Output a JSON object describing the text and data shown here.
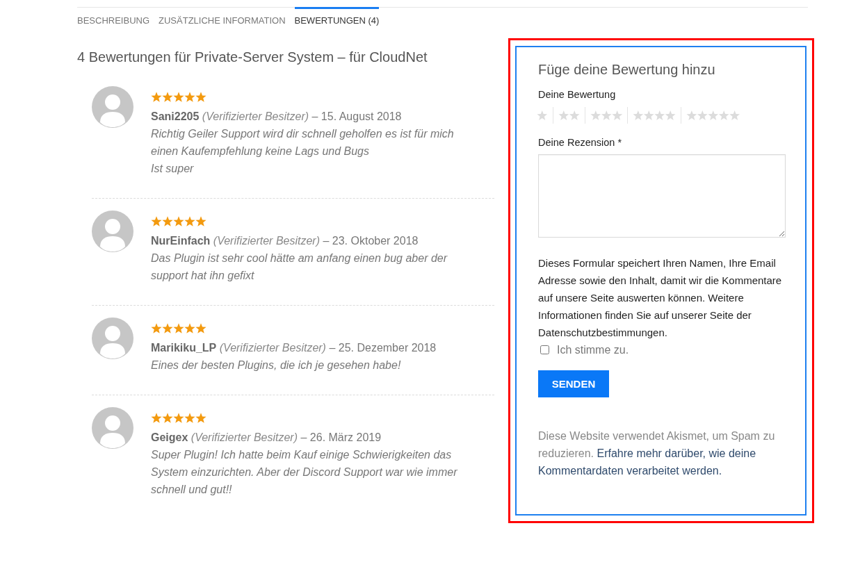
{
  "tabs": [
    {
      "label": "BESCHREIBUNG",
      "selected": false
    },
    {
      "label": "ZUSÄTZLICHE INFORMATION",
      "selected": false
    },
    {
      "label": "BEWERTUNGEN (4)",
      "selected": true
    }
  ],
  "reviews_title": "4 Bewertungen für Private-Server System – für CloudNet",
  "reviews": [
    {
      "stars": 5,
      "author": "Sani2205",
      "badge": "(Verifizierter Besitzer)",
      "date": "– 15. August 2018",
      "text": [
        "Richtig Geiler Support wird dir schnell geholfen es ist für mich einen Kaufempfehlung keine Lags und Bugs",
        "Ist super"
      ]
    },
    {
      "stars": 5,
      "author": "NurEinfach",
      "badge": "(Verifizierter Besitzer)",
      "date": "– 23. Oktober 2018",
      "text": [
        "Das Plugin ist sehr cool hätte am anfang einen bug aber der support hat ihn gefixt"
      ]
    },
    {
      "stars": 5,
      "author": "Marikiku_LP",
      "badge": "(Verifizierter Besitzer)",
      "date": "– 25. Dezember 2018",
      "text": [
        "Eines der besten Plugins, die ich je gesehen habe!"
      ]
    },
    {
      "stars": 5,
      "author": "Geigex",
      "badge": "(Verifizierter Besitzer)",
      "date": "– 26. März 2019",
      "text": [
        "Super Plugin! Ich hatte beim Kauf einige Schwierigkeiten das System einzurichten. Aber der Discord Support war wie immer schnell und gut!!"
      ]
    }
  ],
  "review_form": {
    "highlighted": true,
    "title": "Füge deine Bewertung hinzu",
    "rating_label": "Deine Bewertung",
    "rating_options": [
      {
        "selected": false
      },
      {
        "selected": false
      },
      {
        "selected": false
      },
      {
        "selected": false
      },
      {
        "selected": false
      }
    ],
    "review_label": "Deine Rezension *",
    "privacy_notice": "Dieses Formular speichert Ihren Namen, Ihre Email Adresse sowie den Inhalt, damit wir die Kommentare auf unsere Seite auswerten können. Weitere Informationen finden Sie auf unserer Seite der Datenschutzbestimmungen.",
    "consent": {
      "label": "Ich stimme zu.",
      "checked": false
    },
    "submit": "SENDEN",
    "spam_notice": {
      "text": "Diese Website verwendet Akismet, um Spam zu reduzieren.",
      "link": [
        "Erfahre mehr darüber, wie deine",
        "Kommentardaten verarbeitet werden."
      ]
    }
  }
}
